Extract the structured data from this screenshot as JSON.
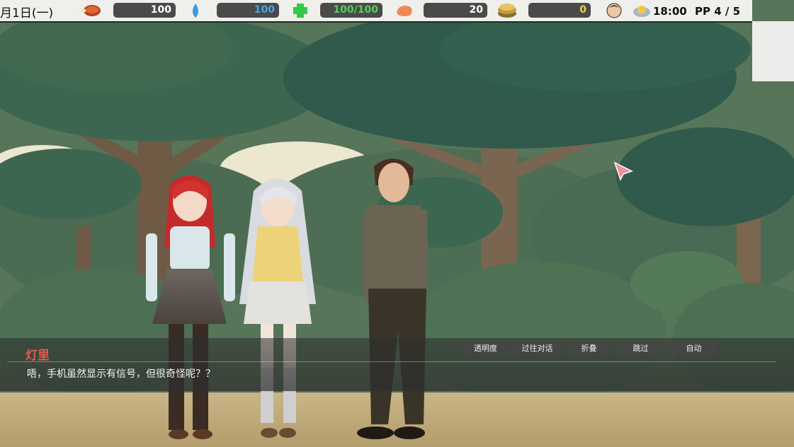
{
  "hud": {
    "date": "月1日(一)",
    "stats": [
      {
        "icon": "meat-icon",
        "value": "100",
        "color": "#ffffff"
      },
      {
        "icon": "water-drop-icon",
        "value": "100",
        "color": "#4aa3e8"
      },
      {
        "icon": "health-cross-icon",
        "value": "100/100",
        "color": "#4fd35a"
      },
      {
        "icon": "shrimp-icon",
        "value": "20",
        "color": "#ffffff"
      },
      {
        "icon": "money-stack-icon",
        "value": "0",
        "color": "#f2d23c"
      }
    ],
    "time": "18:00",
    "pp": "PP 4 / 5"
  },
  "dialogue": {
    "speaker": "灯里",
    "line": "唔，手机虽然显示有信号，但很奇怪呢？？"
  },
  "buttons": {
    "transparency": "透明度",
    "history": "过往对话",
    "fold": "折叠",
    "skip": "跳过",
    "auto": "自动"
  },
  "colors": {
    "speaker": "#e05c4c",
    "hud_bg": "#efefec",
    "bar_bg": "#4a4a4a"
  }
}
